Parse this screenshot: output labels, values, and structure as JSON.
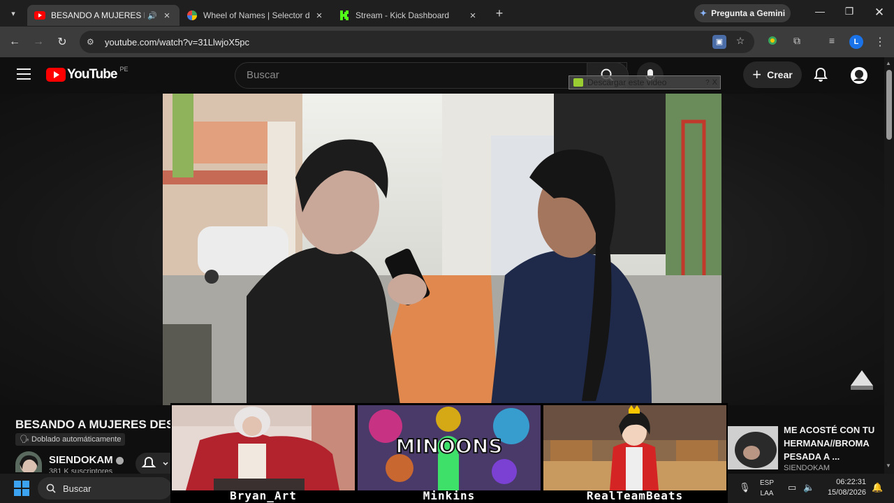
{
  "browser": {
    "tabs": [
      {
        "title": "BESANDO A MUJERES DESCO",
        "active": true,
        "audio": "🔊"
      },
      {
        "title": "Wheel of Names | Selector de n",
        "active": false
      },
      {
        "title": "Stream - Kick Dashboard",
        "active": false
      }
    ],
    "gemini_label": "Pregunta a Gemini",
    "url": "youtube.com/watch?v=31LlwjoX5pc",
    "profile_initial": "L",
    "colors": {
      "yt_red": "#ff0000",
      "kick_green": "#53fc18",
      "accent_blue": "#1a73e8"
    }
  },
  "youtube": {
    "logo_text": "YouTube",
    "country_code": "PE",
    "search_placeholder": "Buscar",
    "create_label": "Crear",
    "download_overlay": "Descargar este video",
    "download_overlay_q": "?",
    "download_overlay_x": "X",
    "video_title": "BESANDO A MUJERES DES",
    "dubbed_label": "Doblado automáticamente",
    "channel_name": "SIENDOKAM",
    "subscribers": "381 K suscriptores",
    "recommended": {
      "title": "ME ACOSTÉ CON TU HERMANA//BROMA PESADA A ...",
      "channel": "SIENDOKAM"
    }
  },
  "stream_overlay": {
    "streamers": [
      {
        "name": "Bryan_Art"
      },
      {
        "name": "Minkins",
        "art_text": "MINOONS"
      },
      {
        "name": "RealTeamBeats"
      }
    ]
  },
  "taskbar": {
    "search_placeholder": "Buscar",
    "lang_top": "ESP",
    "lang_bottom": "LAA",
    "time": "06:22:31",
    "date": "15/08/2026"
  }
}
